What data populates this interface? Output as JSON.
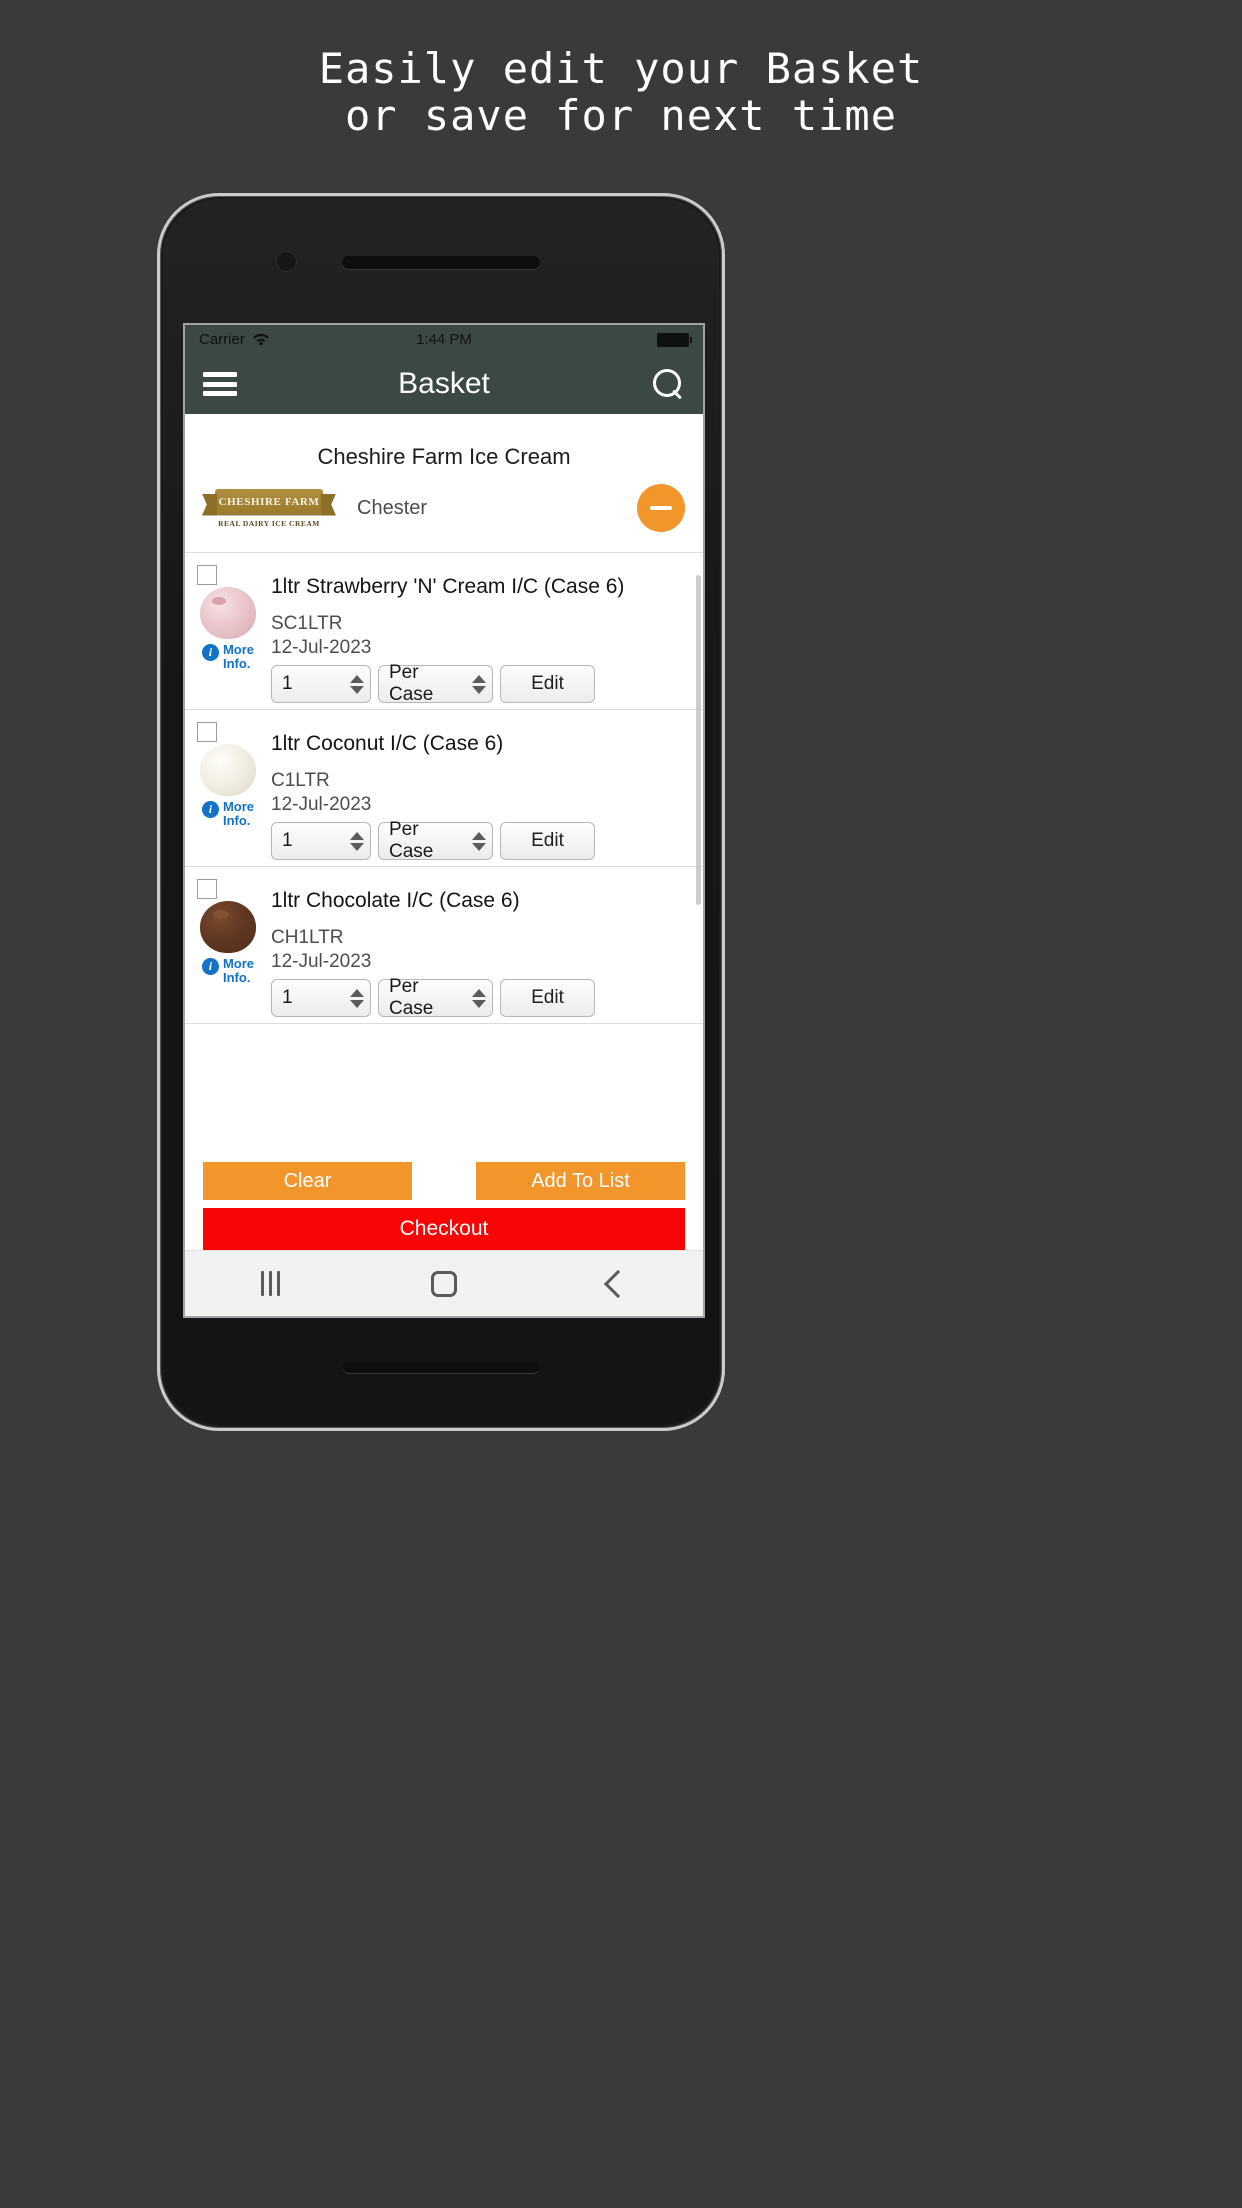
{
  "promo": {
    "line1": "Easily edit your Basket",
    "line2": "or save for next time"
  },
  "status_bar": {
    "carrier": "Carrier",
    "wifi_icon": "wifi-icon",
    "time": "1:44 PM",
    "battery_icon": "battery-full-icon"
  },
  "navbar": {
    "menu_icon": "hamburger-menu-icon",
    "title": "Basket",
    "search_icon": "search-icon"
  },
  "supplier": {
    "name": "Cheshire Farm Ice Cream",
    "city": "Chester",
    "logo_title": "CHESHIRE FARM",
    "logo_subtitle": "REAL DAIRY ICE CREAM",
    "remove_icon": "minus-circle-icon"
  },
  "more_info_label_line1": "More",
  "more_info_label_line2": "Info.",
  "products": [
    {
      "name": "1ltr Strawberry 'N' Cream I/C (Case 6)",
      "code": "SC1LTR",
      "date": "12-Jul-2023",
      "qty": "1",
      "unit": "Per Case",
      "edit_label": "Edit",
      "thumb": "strawberry-ice-cream-scoop"
    },
    {
      "name": "1ltr Coconut I/C (Case 6)",
      "code": "C1LTR",
      "date": "12-Jul-2023",
      "qty": "1",
      "unit": "Per Case",
      "edit_label": "Edit",
      "thumb": "coconut-ice-cream-scoop"
    },
    {
      "name": "1ltr Chocolate I/C (Case 6)",
      "code": "CH1LTR",
      "date": "12-Jul-2023",
      "qty": "1",
      "unit": "Per Case",
      "edit_label": "Edit",
      "thumb": "chocolate-ice-cream-scoop"
    }
  ],
  "actions": {
    "clear": "Clear",
    "add_to_list": "Add To List",
    "checkout": "Checkout"
  },
  "android_nav": {
    "recents_icon": "recents-icon",
    "home_icon": "home-square-icon",
    "back_icon": "back-chevron-icon"
  },
  "colors": {
    "page_background": "#3a3a3a",
    "header_bar": "#3b4846",
    "accent_orange": "#f2952b",
    "checkout_red": "#fa0505",
    "link_blue": "#1273c6",
    "logo_gold": "#9a7a2e"
  }
}
